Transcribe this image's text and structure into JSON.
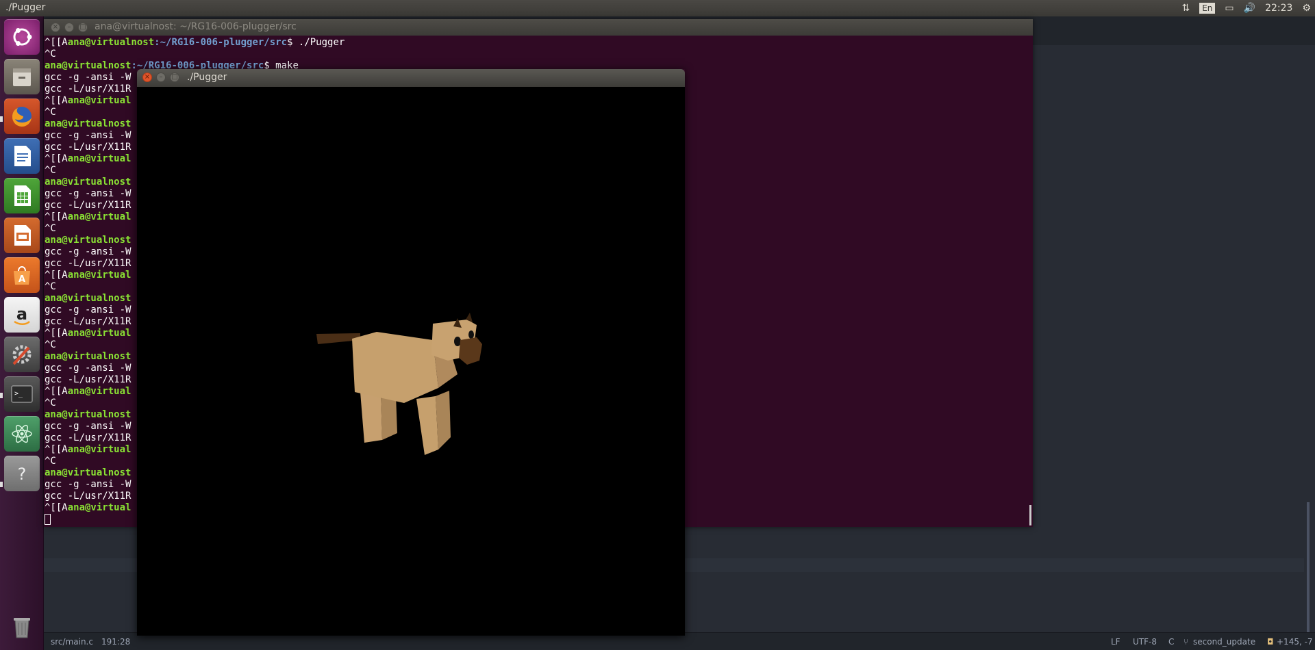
{
  "top_panel": {
    "title": "./Pugger",
    "keyboard_layout": "En",
    "time": "22:23"
  },
  "launcher": {
    "items": [
      {
        "name": "ubuntu-dash",
        "label": "Dash"
      },
      {
        "name": "files",
        "label": "Files"
      },
      {
        "name": "firefox",
        "label": "Firefox"
      },
      {
        "name": "writer",
        "label": "LibreOffice Writer"
      },
      {
        "name": "calc",
        "label": "LibreOffice Calc"
      },
      {
        "name": "impress",
        "label": "LibreOffice Impress"
      },
      {
        "name": "software-center",
        "label": "Ubuntu Software"
      },
      {
        "name": "amazon",
        "label": "Amazon"
      },
      {
        "name": "system-settings",
        "label": "System Settings"
      },
      {
        "name": "terminal",
        "label": "Terminal"
      },
      {
        "name": "atom",
        "label": "Atom"
      },
      {
        "name": "unknown-app",
        "label": "?"
      },
      {
        "name": "trash",
        "label": "Trash"
      }
    ]
  },
  "terminal": {
    "title": "ana@virtualnost: ~/RG16-006-plugger/src",
    "line0": {
      "pre": "^[[A",
      "user": "ana@virtualnost",
      "path": ":~/RG16-006-plugger/src",
      "cmd": "$ ./Pugger"
    },
    "line1": "^C",
    "line2": {
      "user": "ana@virtualnost",
      "path": ":~/RG16-006-plugger/src",
      "cmd": "$ make"
    },
    "gcc1": "gcc -g -ansi -W",
    "gcc2": "gcc -L/usr/X11R",
    "aprompt_pre": "^[[A",
    "aprompt_user": "ana@virtual",
    "ctrlc": "^C",
    "prompt_user": "ana@virtualnost"
  },
  "pugger": {
    "title": "./Pugger"
  },
  "status_bar": {
    "file": "src/main.c",
    "cursor": "191:28",
    "line_ending": "LF",
    "encoding": "UTF-8",
    "grammar": "C",
    "branch": "second_update",
    "diff": "+145, -7"
  },
  "colors": {
    "dog_body": "#c19a6b",
    "dog_tail": "#4a2e16",
    "terminal_bg": "#300a24",
    "prompt_green": "#8ae234",
    "path_blue": "#729fcf"
  }
}
